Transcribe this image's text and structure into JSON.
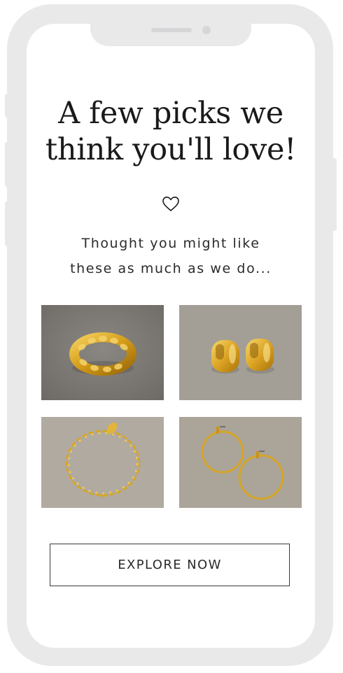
{
  "headline": {
    "line1": "A few picks we",
    "line2": "think you'll love!"
  },
  "icons": {
    "heart": "heart-outline-icon"
  },
  "subtitle": {
    "line1": "Thought you might like",
    "line2": "these as much as we do..."
  },
  "products": [
    {
      "kind": "braided-ring"
    },
    {
      "kind": "huggie-earrings"
    },
    {
      "kind": "chain-bracelet"
    },
    {
      "kind": "hoop-earrings"
    }
  ],
  "cta": {
    "label": "EXPLORE NOW"
  },
  "colors": {
    "frame": "#e9e9ea",
    "text": "#1a1a1a",
    "gold": "#d9a521",
    "stone_dark": "#7d7a76",
    "stone_light": "#b2aca2"
  }
}
